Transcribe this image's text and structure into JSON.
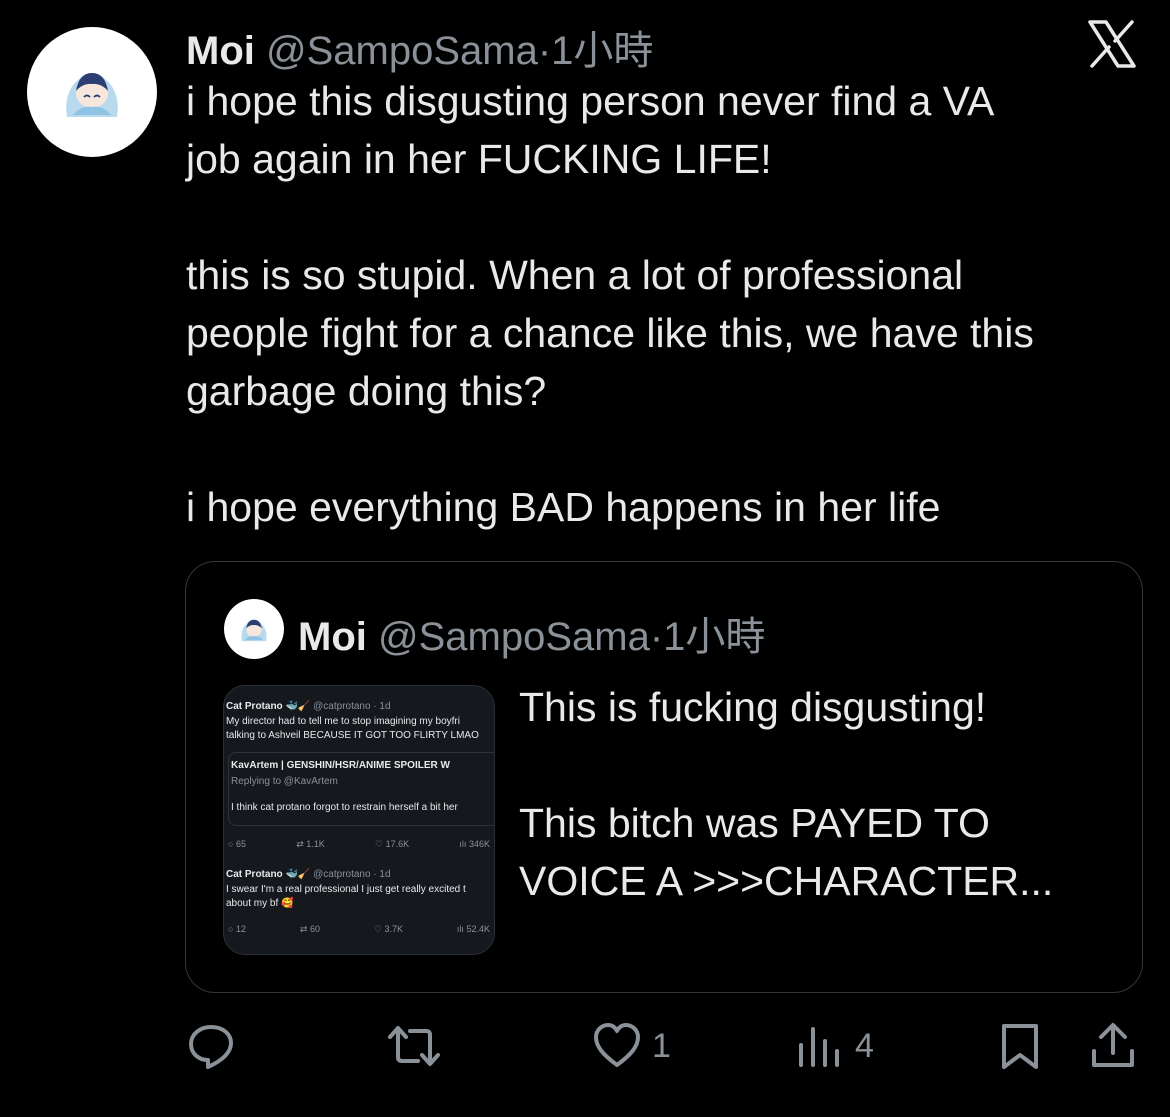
{
  "tweet": {
    "name": "Moi",
    "handle": "@SampoSama",
    "separator": "·",
    "time": "1小時",
    "body": [
      "i hope this disgusting person never find a VA",
      "job again in her FUCKING LIFE!",
      "",
      "this is so stupid. When a lot of professional",
      "people fight for a chance like this, we have this",
      "garbage doing this?",
      "",
      "i hope everything BAD happens in her life"
    ]
  },
  "quote": {
    "name": "Moi",
    "handle": "@SampoSama",
    "separator": "·",
    "time": "1小時",
    "text": [
      "This is fucking disgusting!",
      "",
      "This bitch was PAYED TO",
      "VOICE A >>>CHARACTER..."
    ],
    "image": {
      "t1_name": "Cat Protano 🐳🧹",
      "t1_handle": "@catprotano · 1d",
      "t1_line1": "My director had to tell me to stop imagining my boyfri",
      "t1_line2": "talking to Ashveil BECAUSE IT GOT TOO FLIRTY LMAO",
      "r_name": "KavArtem | GENSHIN/HSR/ANIME SPOILER W",
      "r_reply": "Replying to @KavArtem",
      "r_text": "I think cat protano forgot to restrain herself a bit her",
      "t1_stats": [
        "65",
        "1.1K",
        "17.6K",
        "346K"
      ],
      "t2_name": "Cat Protano 🐳🧹",
      "t2_handle": "@catprotano · 1d",
      "t2_line1": "I swear I'm a real professional I just get really excited t",
      "t2_line2": "about my bf 🥰",
      "t2_stats": [
        "12",
        "60",
        "3.7K",
        "52.4K"
      ]
    }
  },
  "actions": {
    "reply_icon": "reply-icon",
    "retweet_icon": "retweet-icon",
    "like_icon": "heart-icon",
    "like_count": "1",
    "views_icon": "views-icon",
    "views_count": "4",
    "bookmark_icon": "bookmark-icon",
    "share_icon": "share-icon"
  },
  "colors": {
    "background": "#000000",
    "text": "#e7e9ea",
    "muted": "#8b9198",
    "border": "#333639"
  }
}
